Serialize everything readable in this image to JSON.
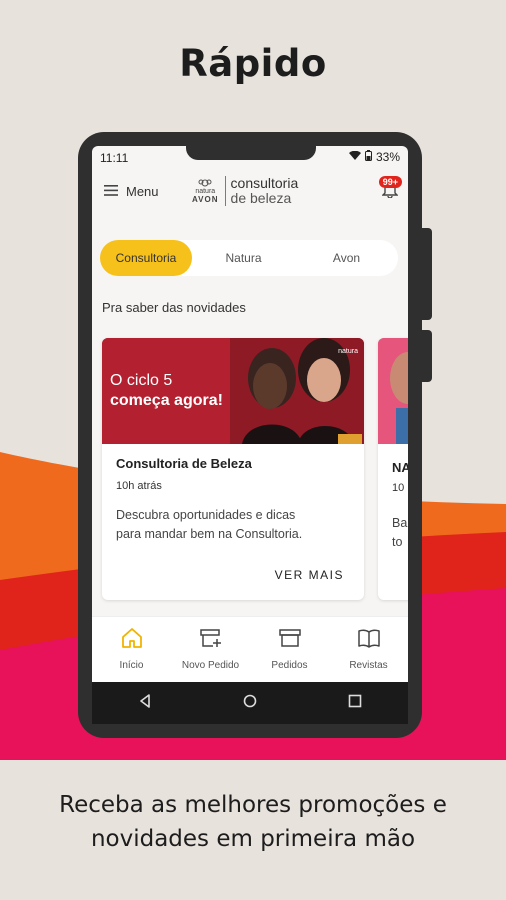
{
  "headline": "Rápido",
  "caption": {
    "line1": "Receba as melhores promoções e",
    "line2": "novidades em primeira mão"
  },
  "status_bar": {
    "time": "11:11",
    "battery": "33%"
  },
  "app_bar": {
    "menu_label": "Menu",
    "logo_brand_top": "natura",
    "logo_brand_bottom": "AVON",
    "logo_line1": "consultoria",
    "logo_line2": "de beleza",
    "notification_badge": "99+"
  },
  "segments": [
    {
      "label": "Consultoria",
      "active": true
    },
    {
      "label": "Natura",
      "active": false
    },
    {
      "label": "Avon",
      "active": false
    }
  ],
  "section_title": "Pra saber das novidades",
  "cards": [
    {
      "banner_line1": "O ciclo 5",
      "banner_line2": "começa agora!",
      "banner_brand": "natura",
      "title": "Consultoria de Beleza",
      "time": "10h atrás",
      "desc_line1": "Descubra oportunidades e dicas",
      "desc_line2": "para mandar bem na Consultoria.",
      "cta": "VER MAIS"
    },
    {
      "title": "NA",
      "time": "10",
      "desc_line1": "Ba",
      "desc_line2": "to"
    }
  ],
  "tabs": [
    {
      "label": "Início",
      "icon": "home-icon"
    },
    {
      "label": "Novo Pedido",
      "icon": "new-order-icon"
    },
    {
      "label": "Pedidos",
      "icon": "orders-icon"
    },
    {
      "label": "Revistas",
      "icon": "magazine-icon"
    }
  ],
  "colors": {
    "accent": "#f7c11b",
    "banner": "#b3202f",
    "wave_orange": "#f06a1e",
    "wave_red": "#e0241b",
    "wave_pink": "#e8125a"
  }
}
